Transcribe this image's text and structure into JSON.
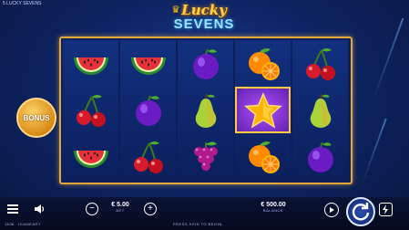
{
  "game": {
    "small_title": "5 LUCKY SEVENS",
    "logo_top": "Lucky",
    "logo_bottom": "SEVENS"
  },
  "bonus": {
    "label": "BONUS"
  },
  "reels": [
    [
      "watermelon",
      "cherry",
      "watermelon"
    ],
    [
      "watermelon",
      "plum",
      "cherry"
    ],
    [
      "plum",
      "pear",
      "grapes"
    ],
    [
      "orange",
      "star",
      "orange"
    ],
    [
      "cherry",
      "pear",
      "plum"
    ]
  ],
  "highlight": {
    "reel": 3,
    "row": 1
  },
  "bottom_bar": {
    "bet_value": "€ 5.00",
    "bet_label": "BET",
    "balance_value": "€ 500.00",
    "balance_label": "BALANCE",
    "time": "13:08",
    "brand": "IGAMEART",
    "hint": "PRESS SPIN TO BEGIN"
  },
  "icons": [
    "menu-icon",
    "sound-icon",
    "minus-icon",
    "plus-icon",
    "autoplay-icon",
    "spin-icon",
    "turbo-icon"
  ],
  "colors": {
    "frame": "#e2a93a",
    "background": "#0f2566",
    "highlight": "#b24dff"
  }
}
